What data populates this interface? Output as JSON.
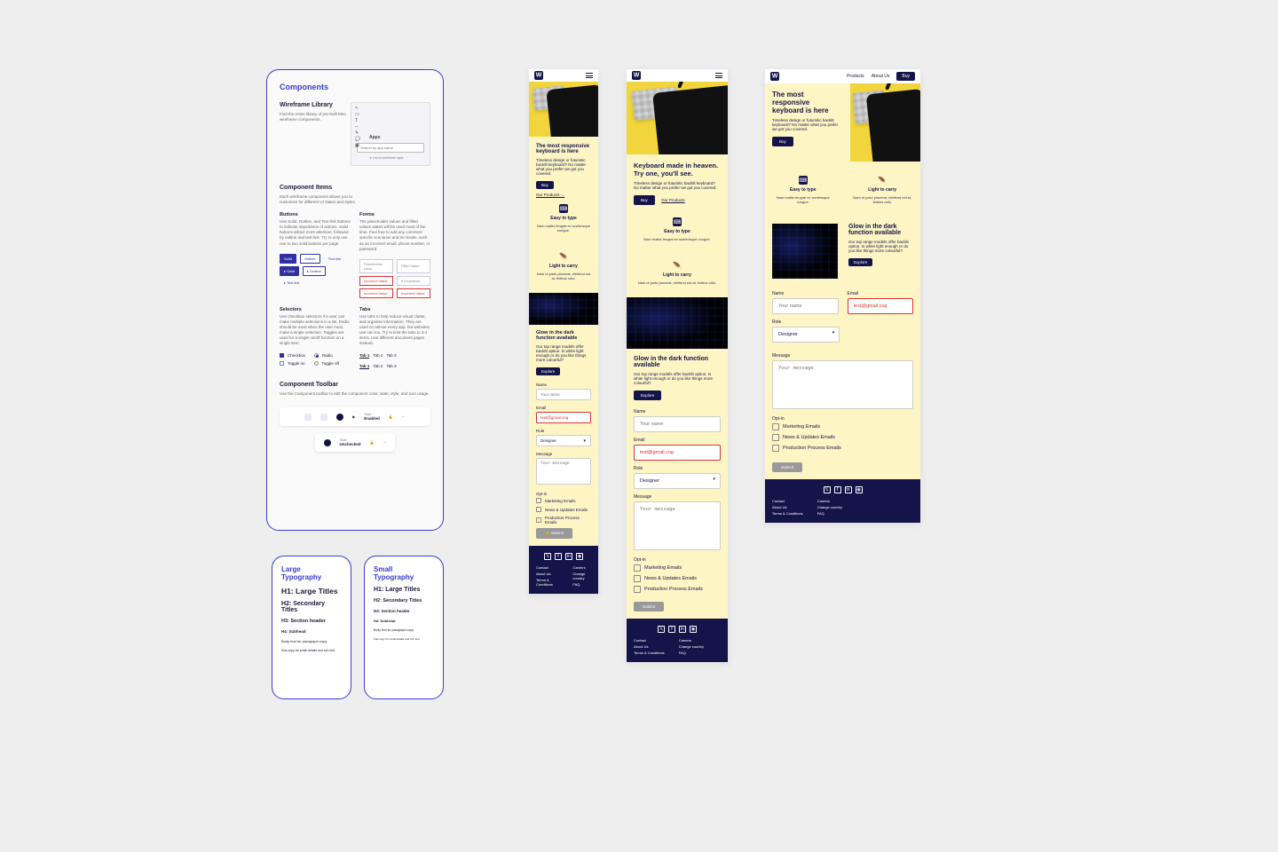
{
  "components": {
    "title": "Components",
    "lib": {
      "h": "Wireframe Library",
      "p": "Find the entire library of pre-built Miro wireframe components."
    },
    "palette": {
      "apps": "Apps",
      "search_ph": "Search by app name",
      "hint": "★ List of wireframe apps"
    },
    "items": {
      "h": "Component Items",
      "p": "Each wireframe component allows you to customize for different UI states and styles."
    },
    "buttons": {
      "h": "Buttons",
      "p": "Use Solid, Outline, and Text-link buttons to indicate importance of actions. Solid buttons attract more attention, followed by outline and text-link. Try to only use one to two solid buttons per page.",
      "solid": "Solid",
      "outline": "Outline",
      "text": "Text link",
      "solid_i": "▸ Solid",
      "outline_i": "▸ Outline",
      "text_i": "▸ Text link"
    },
    "forms": {
      "h": "Forms",
      "p": "The placeholder values and filled values states will be used most of the time. Feel free to add any comment specific scenarios and its results, such as an incorrect email, phone number, or password.",
      "ph": "Placeholder value",
      "filled": "Filled Value",
      "err": "Incorrect Value",
      "dd": "▾ Dropdown"
    },
    "selectors": {
      "h": "Selectors",
      "p": "Use checkbox selectors if a user can make multiple selections in a list. Radio should be used when the user must make a single selection. Toggles are used for a single on/off function on a single item.",
      "checkbox": "Checkbox",
      "radio": "Radio",
      "toggle_on": "Toggle on",
      "toggle_off": "Toggle off"
    },
    "tabs": {
      "h": "Tabs",
      "p": "Use tabs to help reduce visual clutter, and organise information. They are used on almost every app, but websites use can too. Try to limit the tabs to 3-4 items. Use different document pages instead.",
      "tab1": "Tab 1",
      "tab2": "Tab 2",
      "tab3": "Tab 3"
    },
    "toolbar": {
      "h": "Component Toolbar",
      "p": "Use the Component toolbar to edit the component color, state, style, and icon usage.",
      "state_lbl": "State",
      "state_val": "Enabled",
      "state2_lbl": "State",
      "state2_val": "Unchecked"
    }
  },
  "typo_large": {
    "title": "Large Typography",
    "h1": "H1: Large Titles",
    "h2": "H2: Secondary Titles",
    "h3": "H3: Section header",
    "h4": "H4: Subhead",
    "body": "Body text for paragraph copy.",
    "small": "Sub-copy for small details and rich text."
  },
  "typo_small": {
    "title": "Small Typography",
    "h1": "H1: Large Titles",
    "h2": "H2: Secondary Titles",
    "h3": "H3: Section header",
    "h4": "H4: Subhead",
    "body": "Body text for paragraph copy.",
    "small": "Sub-copy for small details and rich text."
  },
  "site": {
    "nav": {
      "products": "Products",
      "about": "About Us",
      "buy": "Buy"
    },
    "hero_small": {
      "h": "The most responsive keyboard is here",
      "p": "Timeless design or futuristic backlit keyboard? No matter what you prefer we got you covered.",
      "cta": "Buy",
      "link": "Our Products →"
    },
    "hero_med": {
      "h": "Keyboard made in heaven. Try one, you'll see.",
      "p": "Timeless design or futuristic backlit keyboard? No matter what you prefer we got you covered.",
      "cta": "Buy",
      "link": "Our Products"
    },
    "hero_lg": {
      "h": "The most responsive keyboard is here",
      "p": "Timeless design or futuristic backlit keyboard? No matter what you prefer we got you covered.",
      "cta": "Buy"
    },
    "feat_type": {
      "h": "Easy to type",
      "p": "Nam mattis feugiat ex scelerisque congue."
    },
    "feat_carry": {
      "h": "Light to carry",
      "p": "Nam ut justo placerat, eleifend est at, finibus odio."
    },
    "glow": {
      "h": "Glow in the dark function available",
      "p": "Our top range models offer backlit option. Is white light enough or do you like things more colourful?",
      "cta": "Explore"
    },
    "form": {
      "name_l": "Name",
      "name_ph": "Your name",
      "email_l": "Email",
      "email_err": "test@gmail.cog",
      "role_l": "Role",
      "role_val": "Designer",
      "msg_l": "Message",
      "msg_ph": "Your message",
      "optin_l": "Opt-in",
      "opt1": "Marketing Emails",
      "opt2": "News & Updates Emails",
      "opt3": "Production Process Emails",
      "submit": "Submit",
      "submit_alt": "🔒 Submit"
    },
    "footer": {
      "contact": "Contact",
      "about": "About Us",
      "terms": "Terms & Conditions",
      "careers": "Careers",
      "country": "Change country",
      "faq": "FAQ"
    }
  }
}
